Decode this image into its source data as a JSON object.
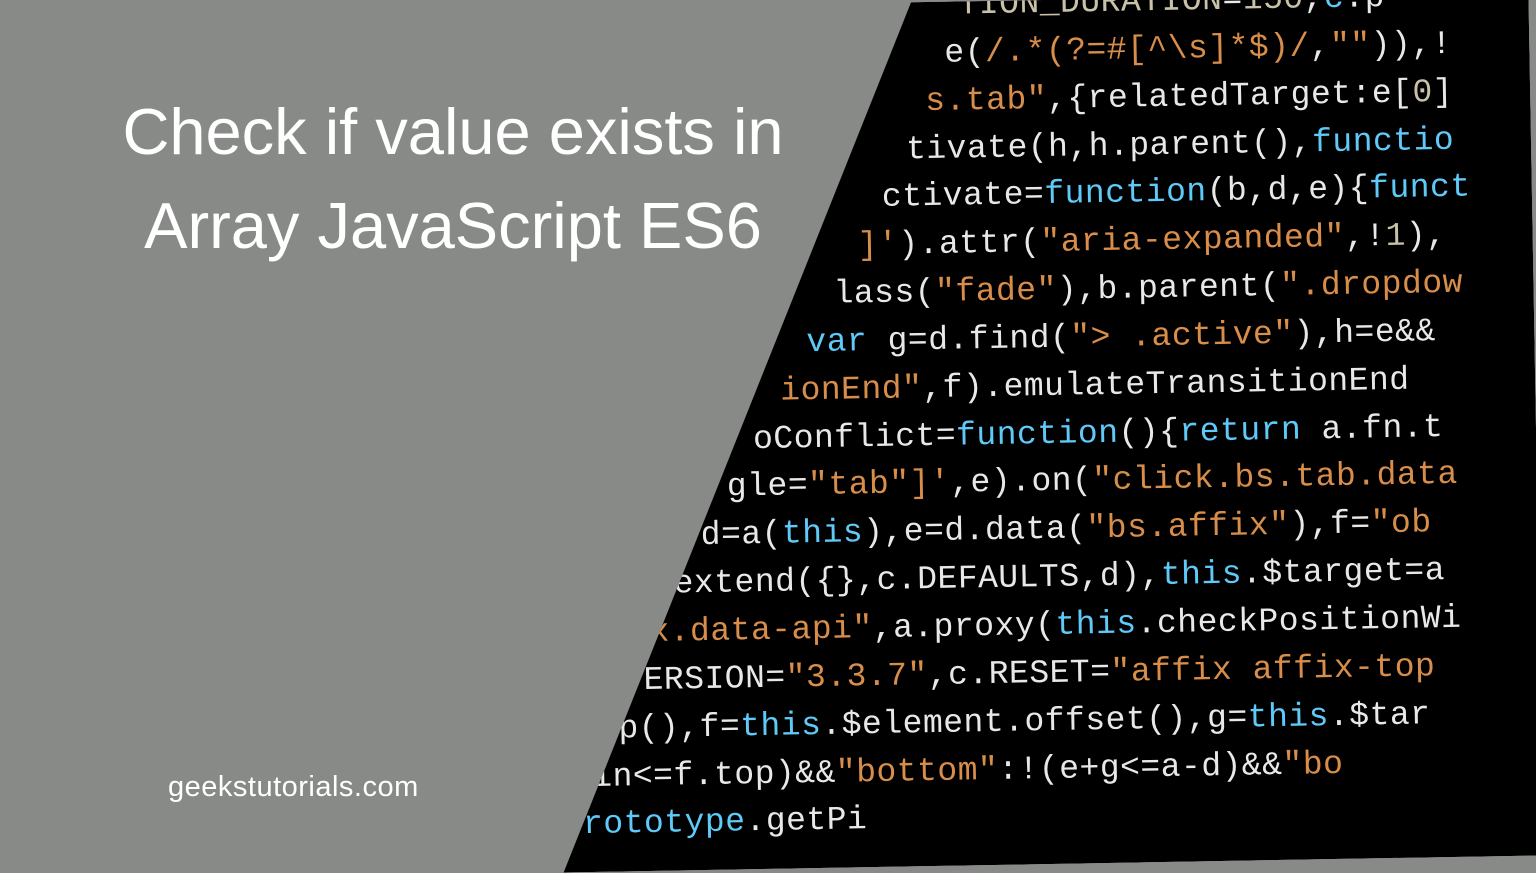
{
  "title": {
    "line1": "Check if value exists in",
    "line2": "Array JavaScript ES6"
  },
  "site_label": "geekstutorials.com",
  "code": {
    "lines": [
      {
        "segments": [
          {
            "t": "TION_DURATION",
            "c": "pale"
          },
          {
            "t": "=",
            "c": "fn"
          },
          {
            "t": "150",
            "c": "pale"
          },
          {
            "t": ",",
            "c": "fn"
          },
          {
            "t": "c",
            "c": "kw"
          },
          {
            "t": ".p",
            "c": "fn"
          }
        ]
      },
      {
        "segments": [
          {
            "t": "e(",
            "c": "fn"
          },
          {
            "t": "/.*(?=#[^\\s]*$)/",
            "c": "str"
          },
          {
            "t": ",",
            "c": "fn"
          },
          {
            "t": "\"\"",
            "c": "str"
          },
          {
            "t": ")),!",
            "c": "fn"
          }
        ]
      },
      {
        "segments": [
          {
            "t": "s.tab\"",
            "c": "str"
          },
          {
            "t": ",{relatedTarget:e[",
            "c": "fn"
          },
          {
            "t": "0",
            "c": "pale"
          },
          {
            "t": "]",
            "c": "fn"
          }
        ]
      },
      {
        "segments": [
          {
            "t": "tivate(h,h.parent(),",
            "c": "fn"
          },
          {
            "t": "functio",
            "c": "kw"
          }
        ]
      },
      {
        "segments": [
          {
            "t": "ctivate=",
            "c": "fn"
          },
          {
            "t": "function",
            "c": "kw"
          },
          {
            "t": "(b,d,e){",
            "c": "fn"
          },
          {
            "t": "funct",
            "c": "kw"
          }
        ]
      },
      {
        "segments": [
          {
            "t": "]'",
            "c": "str"
          },
          {
            "t": ").attr(",
            "c": "fn"
          },
          {
            "t": "\"aria-expanded\"",
            "c": "str"
          },
          {
            "t": ",!",
            "c": "fn"
          },
          {
            "t": "1",
            "c": "pale"
          },
          {
            "t": "),",
            "c": "fn"
          }
        ]
      },
      {
        "segments": [
          {
            "t": "lass(",
            "c": "fn"
          },
          {
            "t": "\"fade\"",
            "c": "str"
          },
          {
            "t": "),b.parent(",
            "c": "fn"
          },
          {
            "t": "\".dropdow",
            "c": "str"
          }
        ]
      },
      {
        "segments": [
          {
            "t": "var ",
            "c": "kw"
          },
          {
            "t": "g=d.find(",
            "c": "fn"
          },
          {
            "t": "\"> .active\"",
            "c": "str"
          },
          {
            "t": "),h=e&&",
            "c": "fn"
          }
        ]
      },
      {
        "segments": [
          {
            "t": "ionEnd\"",
            "c": "str"
          },
          {
            "t": ",f).emulateTransitionEnd",
            "c": "fn"
          }
        ]
      },
      {
        "segments": [
          {
            "t": "oConflict=",
            "c": "fn"
          },
          {
            "t": "function",
            "c": "kw"
          },
          {
            "t": "(){",
            "c": "fn"
          },
          {
            "t": "return ",
            "c": "kw"
          },
          {
            "t": "a.fn.t",
            "c": "fn"
          }
        ]
      },
      {
        "segments": [
          {
            "t": "gle=",
            "c": "fn"
          },
          {
            "t": "\"tab\"",
            "c": "str"
          },
          {
            "t": "]'",
            "c": "str"
          },
          {
            "t": ",e).on(",
            "c": "fn"
          },
          {
            "t": "\"click.bs.tab.data",
            "c": "str"
          }
        ]
      },
      {
        "segments": [
          {
            "t": "d=a(",
            "c": "fn"
          },
          {
            "t": "this",
            "c": "kw"
          },
          {
            "t": "),e=d.data(",
            "c": "fn"
          },
          {
            "t": "\"bs.affix\"",
            "c": "str"
          },
          {
            "t": "),f=",
            "c": "fn"
          },
          {
            "t": "\"ob",
            "c": "str"
          }
        ]
      },
      {
        "segments": [
          {
            "t": "extend({},c.DEFAULTS,d),",
            "c": "fn"
          },
          {
            "t": "this",
            "c": "kw"
          },
          {
            "t": ".$target=a",
            "c": "fn"
          }
        ]
      },
      {
        "segments": [
          {
            "t": "x.data-api\"",
            "c": "str"
          },
          {
            "t": ",a.proxy(",
            "c": "fn"
          },
          {
            "t": "this",
            "c": "kw"
          },
          {
            "t": ".checkPositionWi",
            "c": "fn"
          }
        ]
      },
      {
        "segments": [
          {
            "t": "VERSION=",
            "c": "fn"
          },
          {
            "t": "\"3.3.7\"",
            "c": "str"
          },
          {
            "t": ",c.RESET=",
            "c": "fn"
          },
          {
            "t": "\"affix affix-top",
            "c": "str"
          }
        ]
      },
      {
        "segments": [
          {
            "t": "op(),f=",
            "c": "fn"
          },
          {
            "t": "this",
            "c": "kw"
          },
          {
            "t": ".$element.offset(),g=",
            "c": "fn"
          },
          {
            "t": "this",
            "c": "kw"
          },
          {
            "t": ".$tar",
            "c": "fn"
          }
        ]
      },
      {
        "segments": [
          {
            "t": "pin<=f.top)&&",
            "c": "fn"
          },
          {
            "t": "\"bottom\"",
            "c": "str"
          },
          {
            "t": ":!(e+g<=a-d)&&",
            "c": "fn"
          },
          {
            "t": "\"bo",
            "c": "str"
          }
        ]
      },
      {
        "segments": [
          {
            "t": "prototype",
            "c": "kw"
          },
          {
            "t": ".getPi",
            "c": "fn"
          }
        ]
      }
    ]
  }
}
